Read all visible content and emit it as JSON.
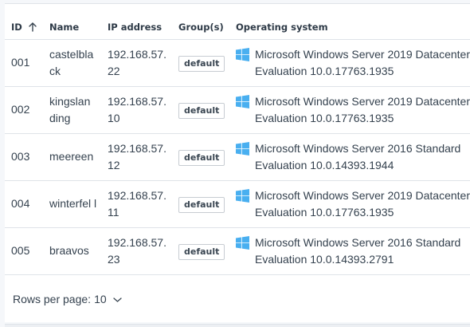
{
  "table": {
    "headers": {
      "id": "ID",
      "name": "Name",
      "ip": "IP address",
      "groups": "Group(s)",
      "os": "Operating system"
    },
    "sort": {
      "column": "id",
      "direction": "ascending"
    },
    "rows": [
      {
        "id": "001",
        "name": "castelbla ck",
        "ip": "192.168.57. 22",
        "group": "default",
        "os": "Microsoft Windows Server 2019 Datacenter Evaluation 10.0.17763.1935"
      },
      {
        "id": "002",
        "name": "kingslan ding",
        "ip": "192.168.57. 10",
        "group": "default",
        "os": "Microsoft Windows Server 2019 Datacenter Evaluation 10.0.17763.1935"
      },
      {
        "id": "003",
        "name": "meereen",
        "ip": "192.168.57. 12",
        "group": "default",
        "os": "Microsoft Windows Server 2016 Standard Evaluation 10.0.14393.1944"
      },
      {
        "id": "004",
        "name": "winterfel l",
        "ip": "192.168.57. 11",
        "group": "default",
        "os": "Microsoft Windows Server 2019 Datacenter Evaluation 10.0.17763.1935"
      },
      {
        "id": "005",
        "name": "braavos",
        "ip": "192.168.57. 23",
        "group": "default",
        "os": "Microsoft Windows Server 2016 Standard Evaluation 10.0.14393.2791"
      }
    ]
  },
  "pagination": {
    "rows_per_page_label": "Rows per page:",
    "rows_per_page_value": "10"
  },
  "colors": {
    "windows_logo": "#49aff0",
    "border": "#dfe3e8",
    "text": "#35424f"
  },
  "icons": {
    "sort": "arrow-up-icon",
    "os": "windows-logo-icon",
    "dropdown": "chevron-down-icon"
  }
}
